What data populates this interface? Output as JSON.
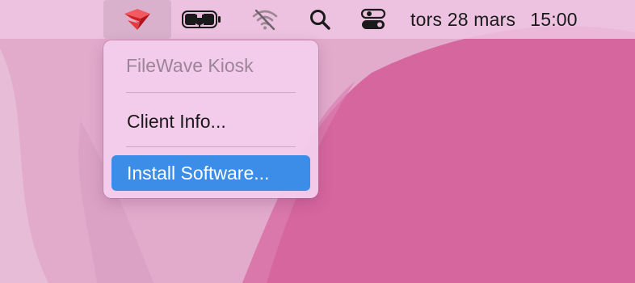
{
  "menubar": {
    "icons": [
      "filewave-logo-icon",
      "battery-charging-icon",
      "wifi-off-icon",
      "search-icon",
      "control-center-icon"
    ],
    "date": "tors 28 mars",
    "time": "15:00"
  },
  "menu": {
    "header": "FileWave Kiosk",
    "items": [
      {
        "label": "Client Info..."
      },
      {
        "label": "Install Software...",
        "highlighted": true
      }
    ]
  },
  "colors": {
    "highlight": "#3b8de8",
    "logo": "#e0252d",
    "wallpaper_accent": "#d6669e"
  }
}
